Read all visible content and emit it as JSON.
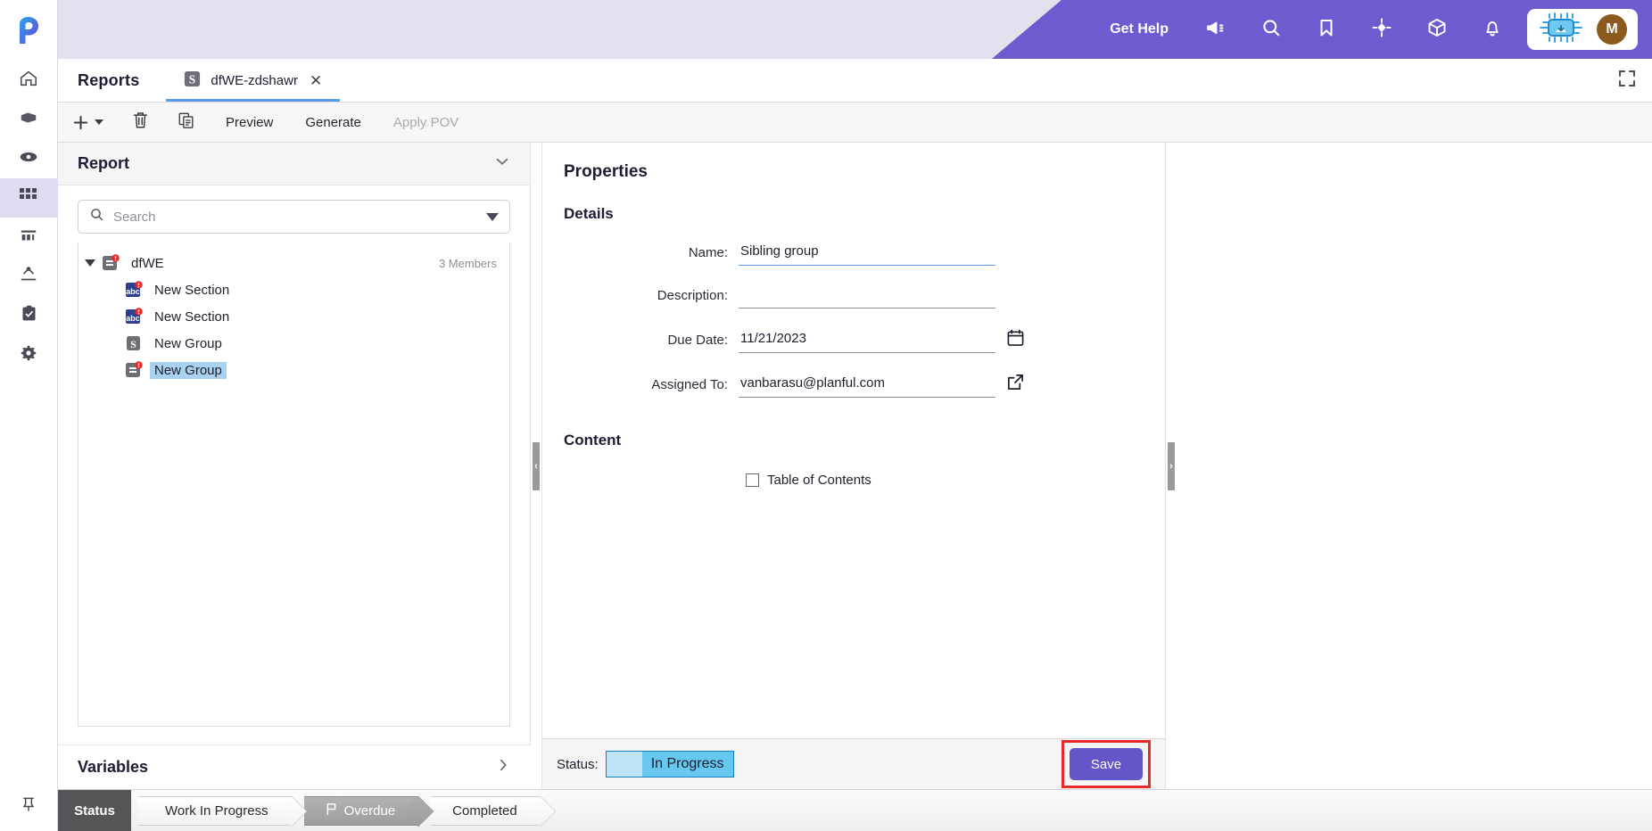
{
  "app": {
    "brand_logo": "planful-p-logo",
    "accent_purple": "#6c5cd0",
    "accent_light": "#e4e0ee",
    "selection_blue": "#a8d2f0",
    "highlight_red": "#e8292c"
  },
  "rail": {
    "items": [
      {
        "name": "home",
        "icon": "home-icon",
        "active": false
      },
      {
        "name": "package",
        "icon": "box-icon",
        "active": false
      },
      {
        "name": "visibility",
        "icon": "eye-icon",
        "active": false
      },
      {
        "name": "apps",
        "icon": "grid-icon",
        "active": true
      },
      {
        "name": "reports",
        "icon": "bar-chart-icon",
        "active": false
      },
      {
        "name": "consolidation",
        "icon": "hierarchy-icon",
        "active": false
      },
      {
        "name": "tasks",
        "icon": "clipboard-check-icon",
        "active": false
      },
      {
        "name": "settings",
        "icon": "gear-icon",
        "active": false
      }
    ],
    "pin": {
      "name": "pin",
      "icon": "pin-icon"
    }
  },
  "topbar": {
    "get_help": "Get Help",
    "icons": [
      {
        "name": "announcements",
        "icon": "megaphone-icon"
      },
      {
        "name": "search",
        "icon": "search-icon"
      },
      {
        "name": "bookmarks",
        "icon": "bookmark-icon"
      },
      {
        "name": "navigate",
        "icon": "crosshair-icon"
      },
      {
        "name": "packages",
        "icon": "cube-icon"
      },
      {
        "name": "notifications",
        "icon": "bell-icon"
      }
    ],
    "ai_chip": {
      "name": "ai-assistant",
      "icon": "chip-icon"
    },
    "avatar_initial": "M"
  },
  "tabstrip": {
    "section_title": "Reports",
    "tabs": [
      {
        "label": "dfWE-zdshawr",
        "icon": "dollar-doc-icon",
        "active": true,
        "close": "✕"
      }
    ],
    "expand": {
      "name": "fullscreen",
      "icon": "expand-icon"
    }
  },
  "toolbar": {
    "add_label": "+",
    "delete_label": "trash",
    "copy_label": "copy",
    "preview": "Preview",
    "generate": "Generate",
    "apply_pov": "Apply POV"
  },
  "left_panel": {
    "header": "Report",
    "collapse_icon": "chevron-down-icon",
    "search": {
      "placeholder": "Search",
      "value": "",
      "icon": "search-icon",
      "filter_icon": "filter-caret-icon"
    },
    "tree": {
      "root": {
        "label": "dfWE",
        "icon": "group-alert-icon",
        "members": "3 Members",
        "expanded": true
      },
      "children": [
        {
          "label": "New Section",
          "icon": "abc-alert-icon",
          "selected": false
        },
        {
          "label": "New Section",
          "icon": "abc-alert-icon",
          "selected": false
        },
        {
          "label": "New Group",
          "icon": "dollar-doc-icon",
          "selected": false
        },
        {
          "label": "New Group",
          "icon": "group-alert-icon",
          "selected": true
        }
      ]
    },
    "variables": {
      "label": "Variables",
      "expand_icon": "chevron-right-icon"
    }
  },
  "center_panel": {
    "title": "Properties",
    "details_title": "Details",
    "fields": [
      {
        "label": "Name:",
        "value": "Sibling group",
        "focused": true,
        "action": null
      },
      {
        "label": "Description:",
        "value": "",
        "focused": false,
        "action": null
      },
      {
        "label": "Due Date:",
        "value": "11/21/2023",
        "focused": false,
        "action": "calendar-icon"
      },
      {
        "label": "Assigned To:",
        "value": "vanbarasu@planful.com",
        "focused": false,
        "action": "external-link-icon"
      }
    ],
    "content_title": "Content",
    "toc": {
      "label": "Table of Contents",
      "checked": false
    },
    "footer": {
      "status_label": "Status:",
      "status_value": "In Progress",
      "save_label": "Save"
    }
  },
  "workflow": {
    "status_label": "Status",
    "steps": [
      {
        "label": "Work In Progress",
        "current": false,
        "icon": null
      },
      {
        "label": "Overdue",
        "current": true,
        "icon": "flag-icon"
      },
      {
        "label": "Completed",
        "current": false,
        "icon": null
      }
    ]
  }
}
